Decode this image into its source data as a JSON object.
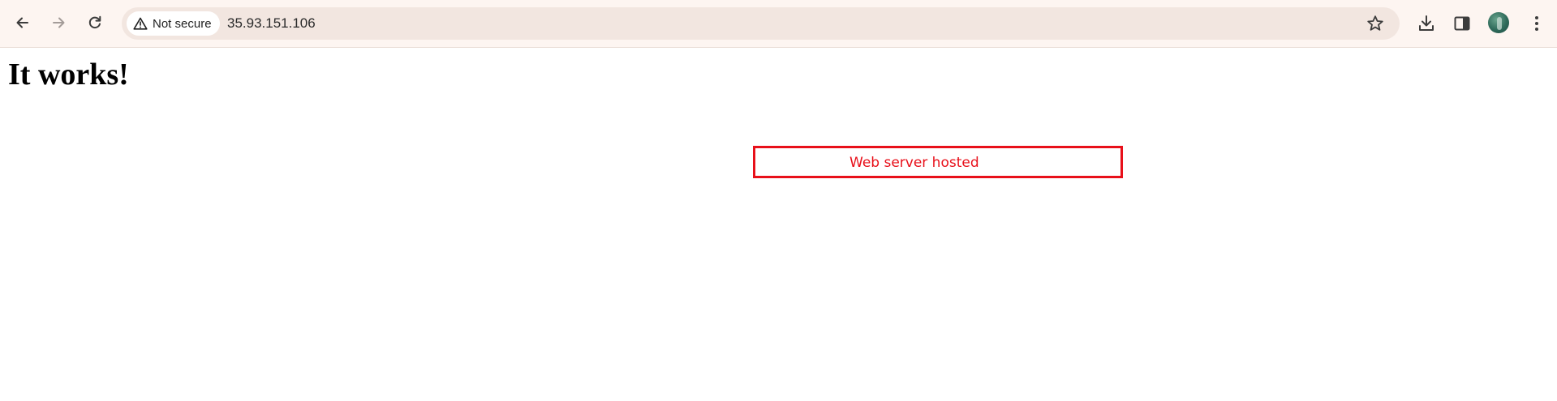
{
  "browser": {
    "security_label": "Not secure",
    "url": "35.93.151.106",
    "icons": {
      "back": "arrow-left-icon",
      "forward": "arrow-right-icon",
      "reload": "reload-icon",
      "security": "warning-triangle-icon",
      "bookmark": "star-icon",
      "downloads": "download-icon",
      "side_panel": "side-panel-icon",
      "profile": "avatar",
      "menu": "kebab-menu-icon"
    }
  },
  "page": {
    "heading": "It works!"
  },
  "annotation": {
    "text": "Web server hosted",
    "color": "#e8101a"
  }
}
